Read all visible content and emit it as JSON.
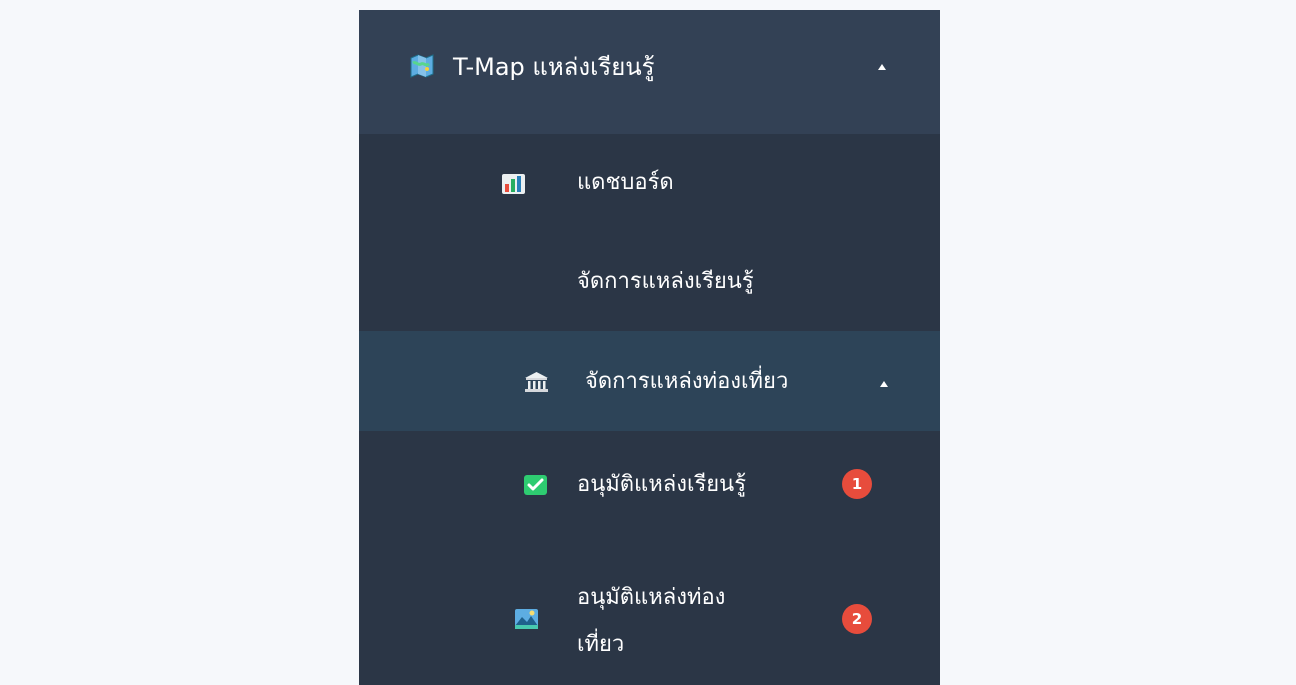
{
  "sidebar": {
    "header": {
      "title": "T-Map แหล่งเรียนรู้",
      "icon": "map-icon",
      "expanded": true
    },
    "items": [
      {
        "label": "แดชบอร์ด",
        "icon": "dashboard-icon"
      },
      {
        "label": "จัดการแหล่งเรียนรู้",
        "icon": ""
      },
      {
        "label": "จัดการแหล่งท่องเที่ยว",
        "icon": "museum-icon",
        "expanded": true
      },
      {
        "label": "อนุมัติแหล่งเรียนรู้",
        "icon": "checkmark-icon",
        "badge": "1"
      },
      {
        "label_line1": "อนุมัติแหล่งท่อง",
        "label_line2": "เที่ยว",
        "icon": "landscape-icon",
        "badge": "2"
      }
    ]
  },
  "colors": {
    "page_background": "#f6f8fb",
    "sidebar_background": "#2b3646",
    "header_background": "#334155",
    "active_submenu_background": "#2d4458",
    "badge_background": "#e74c3c",
    "text": "#ffffff"
  }
}
